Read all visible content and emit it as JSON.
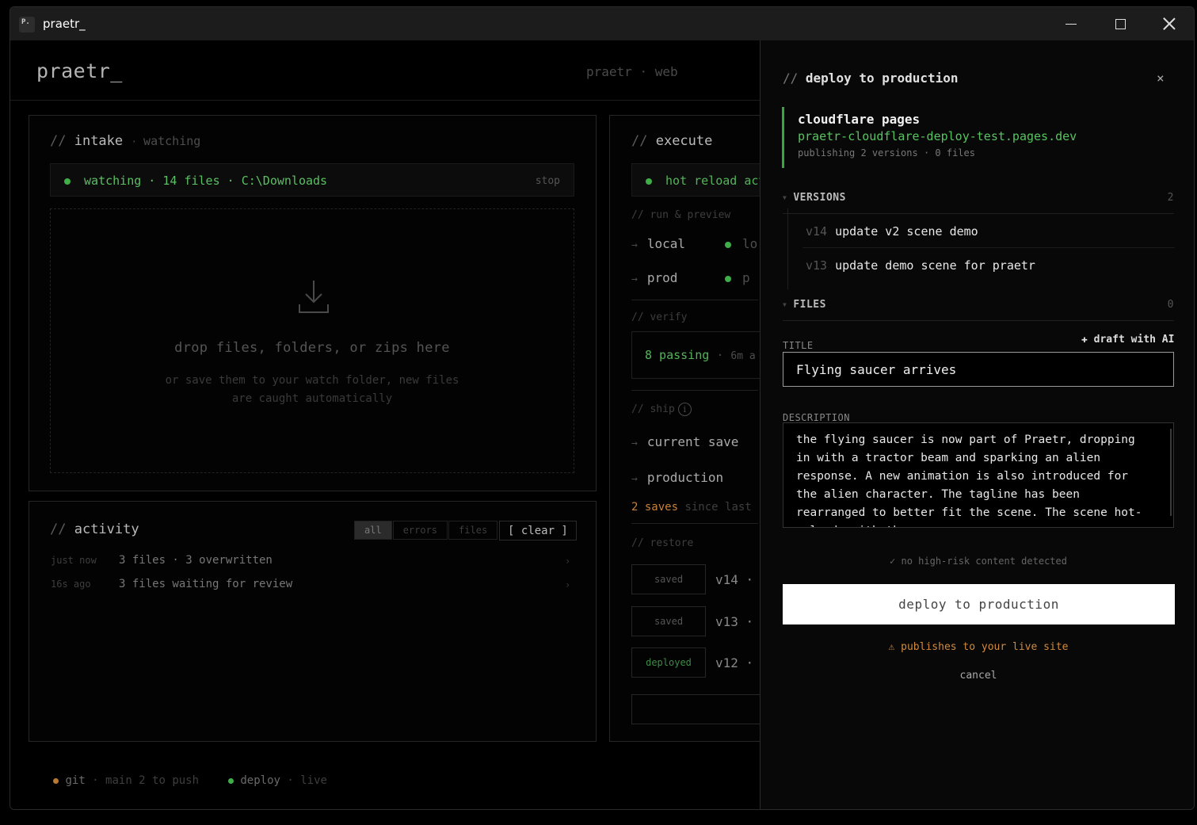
{
  "window": {
    "title": "praetr_",
    "app_icon_text": "P."
  },
  "header": {
    "logo": "praetr_",
    "project": "praetr",
    "sep": "·",
    "env": "web"
  },
  "intake": {
    "title": "intake",
    "state": "watching",
    "status": {
      "watching": "watching",
      "files": "14 files",
      "path": "C:\\Downloads",
      "stop": "stop"
    },
    "dropzone": {
      "title": "drop files, folders, or zips here",
      "sub_line1": "or save them to your watch folder, new files",
      "sub_line2": "are caught automatically"
    }
  },
  "activity": {
    "title": "activity",
    "filters": [
      "all",
      "errors",
      "files"
    ],
    "clear_label": "[ clear ]",
    "rows": [
      {
        "time": "just now",
        "text": "3 files · 3 overwritten"
      },
      {
        "time": "16s ago",
        "text": "3 files waiting for review"
      }
    ]
  },
  "execute": {
    "title": "execute",
    "status": "hot reload act",
    "run_label": "// run & preview",
    "local": {
      "label": "local",
      "status": "lo"
    },
    "prod": {
      "label": "prod",
      "status": "p"
    },
    "verify_label": "// verify",
    "passing": "8 passing",
    "passing_time": "6m a",
    "ship_label": "// ship",
    "current_save": "current save",
    "production": "production",
    "saves_count": "2 saves",
    "saves_rest": "since last",
    "restore_label": "// restore",
    "restore": [
      {
        "status": "saved",
        "version": "v14"
      },
      {
        "status": "saved",
        "version": "v13"
      },
      {
        "status": "deployed",
        "version": "v12"
      }
    ]
  },
  "footer": {
    "git": "git",
    "git_info": "main 2 to push",
    "deploy": "deploy",
    "deploy_info": "live"
  },
  "deploy_panel": {
    "title": "deploy to production",
    "close": "×",
    "target": {
      "name": "cloudflare pages",
      "url": "praetr-cloudflare-deploy-test.pages.dev",
      "meta": "publishing 2 versions · 0 files"
    },
    "versions_label": "VERSIONS",
    "versions_count": "2",
    "versions": [
      {
        "num": "v14",
        "msg": "update v2 scene demo"
      },
      {
        "num": "v13",
        "msg": "update demo scene for praetr"
      }
    ],
    "files_label": "FILES",
    "files_count": "0",
    "title_label": "TITLE",
    "ai_label": "✚ draft with AI",
    "title_value": "Flying saucer arrives",
    "description_label": "DESCRIPTION",
    "description_value": "the flying saucer is now part of Praetr, dropping in with a tractor beam and sparking an alien response. A new animation is also introduced for the alien character. The tagline has been rearranged to better fit the scene. The scene hot-reloads with these",
    "risk_check": "✓ no high-risk content detected",
    "deploy_button": "deploy to production",
    "warning": "⚠ publishes to your live site",
    "cancel": "cancel"
  }
}
